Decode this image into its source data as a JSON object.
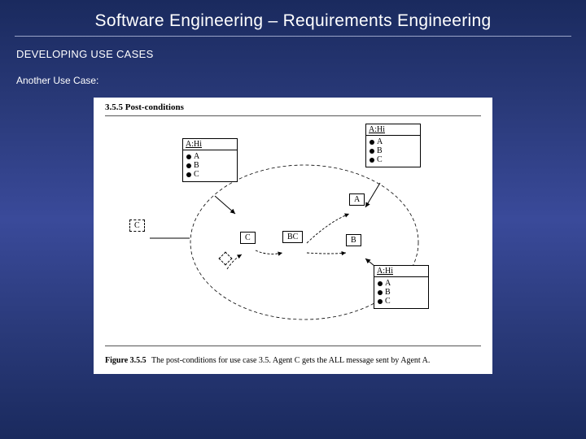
{
  "title": "Software Engineering – Requirements Engineering",
  "section": "DEVELOPING USE CASES",
  "subsection": "Another Use Case:",
  "figure": {
    "heading": "3.5.5 Post-conditions",
    "caption_lead": "Figure 3.5.5",
    "caption_text": "The post-conditions for use case 3.5. Agent C gets the ALL message sent by Agent A.",
    "nodes": {
      "hi_left": {
        "label": "A:Hi",
        "items": [
          "A",
          "B",
          "C"
        ]
      },
      "hi_topright": {
        "label": "A:Hi",
        "items": [
          "A",
          "B",
          "C"
        ]
      },
      "hi_botright": {
        "label": "A:Hi",
        "items": [
          "A",
          "B",
          "C"
        ]
      }
    },
    "tags": {
      "c_outer": "C",
      "c_inner": "C",
      "bc": "BC",
      "a": "A",
      "b": "B"
    }
  }
}
